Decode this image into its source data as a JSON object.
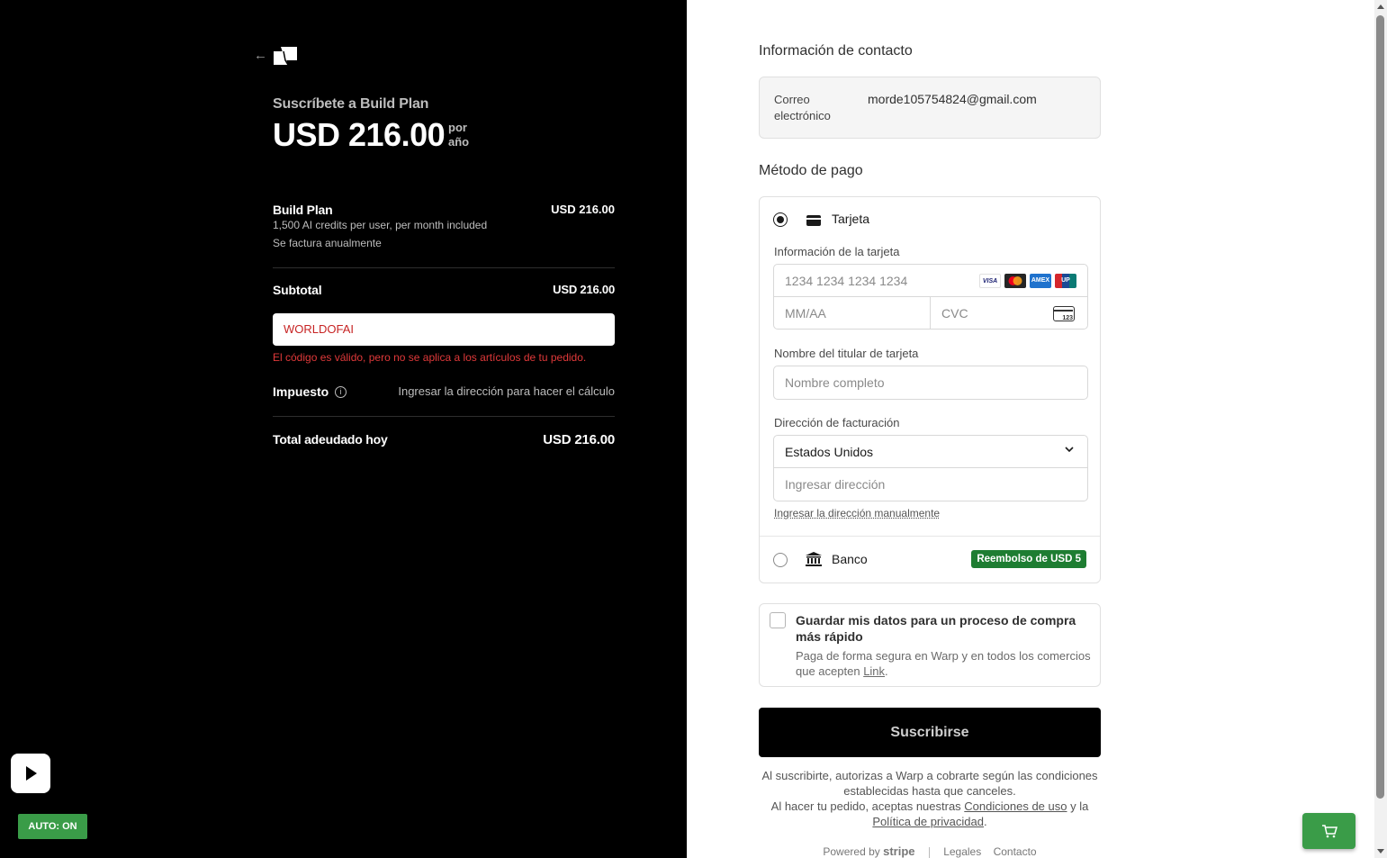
{
  "summary": {
    "back_icon": "arrow-left-icon",
    "logo_icon": "warp-logo-icon",
    "subscribe_title": "Suscríbete a Build Plan",
    "price": "USD 216.00",
    "per_line1": "por",
    "per_line2": "año",
    "line_item": {
      "name": "Build Plan",
      "description": "1,500 AI credits per user, per month included",
      "billing": "Se factura anualmente",
      "price": "USD 216.00"
    },
    "subtotal_label": "Subtotal",
    "subtotal_value": "USD 216.00",
    "promo_code": "WORLDOFAI",
    "promo_error": "El código es válido, pero no se aplica a los artículos de tu pedido.",
    "tax_label": "Impuesto",
    "tax_value": "Ingresar la dirección para hacer el cálculo",
    "total_label": "Total adeudado hoy",
    "total_value": "USD 216.00"
  },
  "overlay": {
    "auto_badge": "AUTO: ON",
    "play_icon": "play-icon",
    "cart_icon": "cart-icon"
  },
  "contact": {
    "title": "Información de contacto",
    "email_label": "Correo electrónico",
    "email_value": "morde105754824@gmail.com"
  },
  "payment": {
    "title": "Método de pago",
    "card_option": "Tarjeta",
    "card_info_label": "Información de la tarjeta",
    "card_number_placeholder": "1234 1234 1234 1234",
    "brands": [
      "VISA",
      "MC",
      "AMEX",
      "UP"
    ],
    "expiry_placeholder": "MM/AA",
    "cvc_placeholder": "CVC",
    "cvc_icon_text": "123",
    "holder_label": "Nombre del titular de tarjeta",
    "holder_placeholder": "Nombre completo",
    "billing_label": "Dirección de facturación",
    "country": "Estados Unidos",
    "address_placeholder": "Ingresar dirección",
    "manual_link": "Ingresar la dirección manualmente",
    "bank_option": "Banco",
    "bank_badge": "Reembolso de USD 5"
  },
  "save": {
    "title": "Guardar mis datos para un proceso de compra más rápido",
    "desc_prefix": "Paga de forma segura en Warp y en todos los comercios que acepten ",
    "link": "Link",
    "desc_suffix": "."
  },
  "submit_label": "Suscribirse",
  "terms": {
    "line1": "Al suscribirte, autorizas a Warp a cobrarte según las condiciones establecidas hasta que canceles.",
    "line2_prefix": "Al hacer tu pedido, aceptas nuestras ",
    "terms_link": "Condiciones de uso",
    "line2_mid": " y la ",
    "privacy_link": "Política de privacidad",
    "line2_suffix": "."
  },
  "footer": {
    "powered_by": "Powered by",
    "stripe": "stripe",
    "legal": "Legales",
    "contact": "Contacto"
  },
  "colors": {
    "left_bg": "#000000",
    "error_red": "#e0393a",
    "badge_green": "#1e7d32",
    "auto_green": "#3a9c48"
  }
}
